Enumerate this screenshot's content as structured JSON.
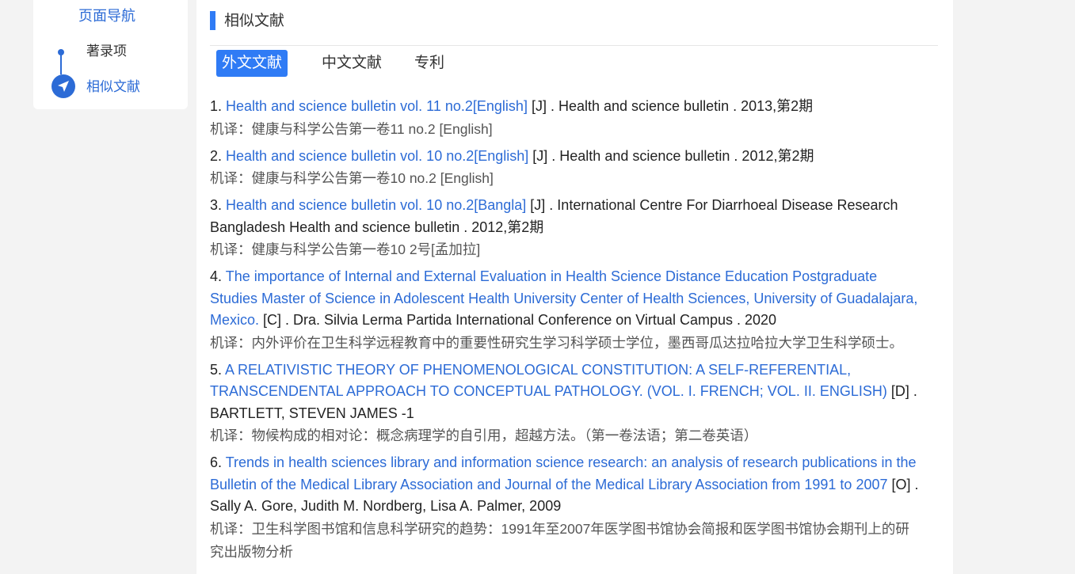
{
  "sidebar": {
    "title": "页面导航",
    "items": [
      {
        "label": "著录项"
      },
      {
        "label": "相似文献"
      }
    ]
  },
  "section": {
    "title": "相似文献"
  },
  "tabs": [
    {
      "label": "外文文献",
      "active": true
    },
    {
      "label": "中文文献",
      "active": false
    },
    {
      "label": "专利",
      "active": false
    }
  ],
  "results": [
    {
      "index": "1.",
      "title": "Health and science bulletin vol. 11 no.2[English]",
      "rest": " [J] . Health and science bulletin . 2013,第2期",
      "translation": "机译：健康与科学公告第一卷11 no.2 [English]"
    },
    {
      "index": "2.",
      "title": "Health and science bulletin vol. 10 no.2[English]",
      "rest": " [J] . Health and science bulletin . 2012,第2期",
      "translation": "机译：健康与科学公告第一卷10 no.2 [English]"
    },
    {
      "index": "3.",
      "title": "Health and science bulletin vol. 10 no.2[Bangla]",
      "rest": " [J] . International Centre For Diarrhoeal Disease Research Bangladesh Health and science bulletin . 2012,第2期",
      "translation": "机译：健康与科学公告第一卷10 2号[孟加拉]"
    },
    {
      "index": "4.",
      "title": "The importance of Internal and External Evaluation in Health Science Distance Education Postgraduate Studies Master of Science in Adolescent Health University Center of Health Sciences, University of Guadalajara, Mexico.",
      "rest": " [C] . Dra. Silvia Lerma Partida International Conference on Virtual Campus . 2020",
      "translation": "机译：内外评价在卫生科学远程教育中的重要性研究生学习科学硕士学位，墨西哥瓜达拉哈拉大学卫生科学硕士。"
    },
    {
      "index": "5.",
      "title": "A RELATIVISTIC THEORY OF PHENOMENOLOGICAL CONSTITUTION: A SELF-REFERENTIAL, TRANSCENDENTAL APPROACH TO CONCEPTUAL PATHOLOGY. (VOL. I. FRENCH; VOL. II. ENGLISH)",
      "rest": " [D] . BARTLETT, STEVEN JAMES -1",
      "translation": "机译：物候构成的相对论：概念病理学的自引用，超越方法。（第一卷法语；第二卷英语）"
    },
    {
      "index": "6.",
      "title": "Trends in health sciences library and information science research: an analysis of research publications in the Bulletin of the Medical Library Association and Journal of the Medical Library Association from 1991 to 2007",
      "rest": " [O] . Sally A. Gore, Judith M. Nordberg, Lisa A. Palmer, 2009",
      "translation": "机译：卫生科学图书馆和信息科学研究的趋势：1991年至2007年医学图书馆协会简报和医学图书馆协会期刊上的研究出版物分析"
    }
  ]
}
